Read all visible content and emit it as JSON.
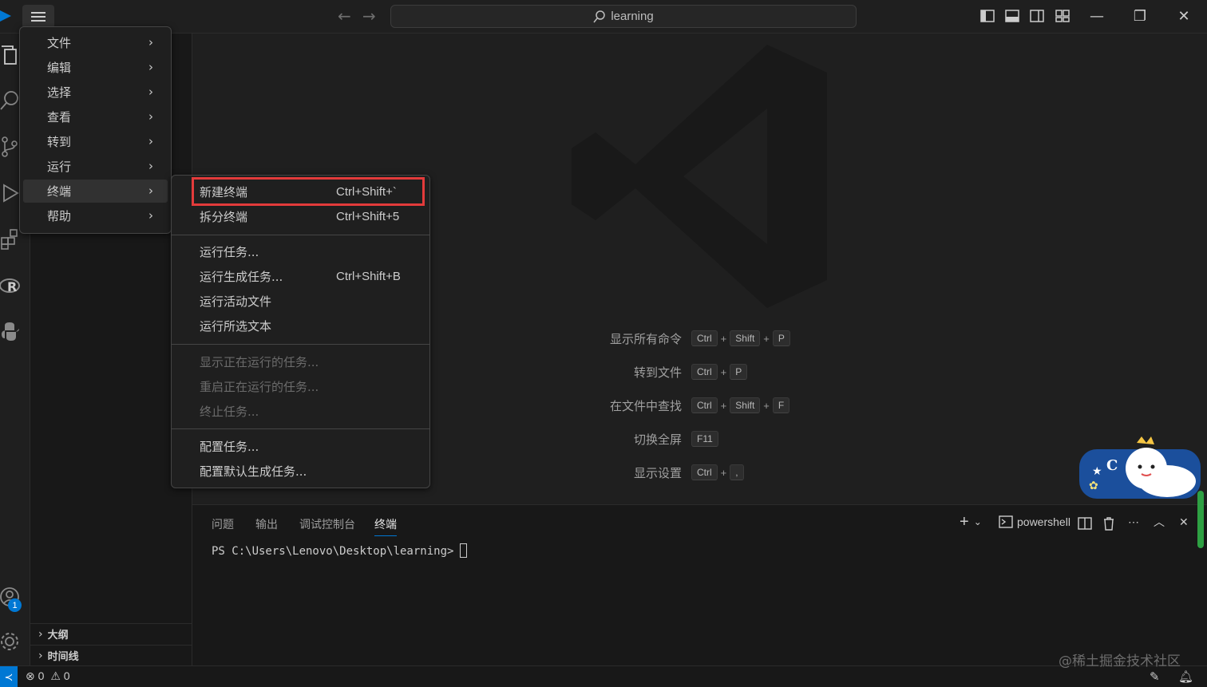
{
  "titlebar": {
    "search_text": "learning",
    "icons": [
      "vscode-logo",
      "menu-icon",
      "arrow-left-icon",
      "arrow-right-icon",
      "search-icon",
      "toggle-primary-sidebar-icon",
      "toggle-panel-icon",
      "toggle-secondary-sidebar-icon",
      "customize-layout-icon",
      "minimize-icon",
      "restore-icon",
      "close-icon"
    ]
  },
  "activity_bar": {
    "icons": [
      "explorer-icon",
      "search-icon",
      "source-control-icon",
      "run-debug-icon",
      "extensions-icon",
      "r-icon",
      "python-icon",
      "accounts-icon",
      "settings-gear-icon"
    ],
    "accounts_badge": "1"
  },
  "sidebar": {
    "sections": [
      {
        "label": "大纲"
      },
      {
        "label": "时间线"
      }
    ]
  },
  "main_menu": {
    "items": [
      {
        "label": "文件"
      },
      {
        "label": "编辑"
      },
      {
        "label": "选择"
      },
      {
        "label": "查看"
      },
      {
        "label": "转到"
      },
      {
        "label": "运行"
      },
      {
        "label": "终端"
      },
      {
        "label": "帮助"
      }
    ],
    "selected_index": 6
  },
  "terminal_menu": {
    "items": [
      {
        "label": "新建终端",
        "shortcut": "Ctrl+Shift+`",
        "enabled": true
      },
      {
        "label": "拆分终端",
        "shortcut": "Ctrl+Shift+5",
        "enabled": true
      },
      {
        "label": "运行任务...",
        "shortcut": "",
        "enabled": true
      },
      {
        "label": "运行生成任务...",
        "shortcut": "Ctrl+Shift+B",
        "enabled": true
      },
      {
        "label": "运行活动文件",
        "shortcut": "",
        "enabled": true
      },
      {
        "label": "运行所选文本",
        "shortcut": "",
        "enabled": true
      },
      {
        "label": "显示正在运行的任务...",
        "shortcut": "",
        "enabled": false
      },
      {
        "label": "重启正在运行的任务...",
        "shortcut": "",
        "enabled": false
      },
      {
        "label": "终止任务...",
        "shortcut": "",
        "enabled": false
      },
      {
        "label": "配置任务...",
        "shortcut": "",
        "enabled": true
      },
      {
        "label": "配置默认生成任务...",
        "shortcut": "",
        "enabled": true
      }
    ],
    "highlighted_item": "新建终端",
    "highlight_color": "#e33b3b"
  },
  "editor": {
    "shortcuts": [
      {
        "label": "显示所有命令",
        "keys": [
          "Ctrl",
          "Shift",
          "P"
        ]
      },
      {
        "label": "转到文件",
        "keys": [
          "Ctrl",
          "P"
        ]
      },
      {
        "label": "在文件中查找",
        "keys": [
          "Ctrl",
          "Shift",
          "F"
        ]
      },
      {
        "label": "切换全屏",
        "keys": [
          "F11"
        ]
      },
      {
        "label": "显示设置",
        "keys": [
          "Ctrl",
          ","
        ]
      }
    ],
    "plus": "+"
  },
  "panel": {
    "tabs": [
      {
        "label": "问题",
        "active": false
      },
      {
        "label": "输出",
        "active": false
      },
      {
        "label": "调试控制台",
        "active": false
      },
      {
        "label": "终端",
        "active": true
      }
    ],
    "terminal_profile": "powershell",
    "prompt": "PS C:\\Users\\Lenovo\\Desktop\\learning>",
    "accent_color": "#0078d4"
  },
  "statusbar": {
    "errors": "0",
    "warnings": "0"
  },
  "watermark": "@稀土掘金技术社区",
  "mascot_letter": "C"
}
